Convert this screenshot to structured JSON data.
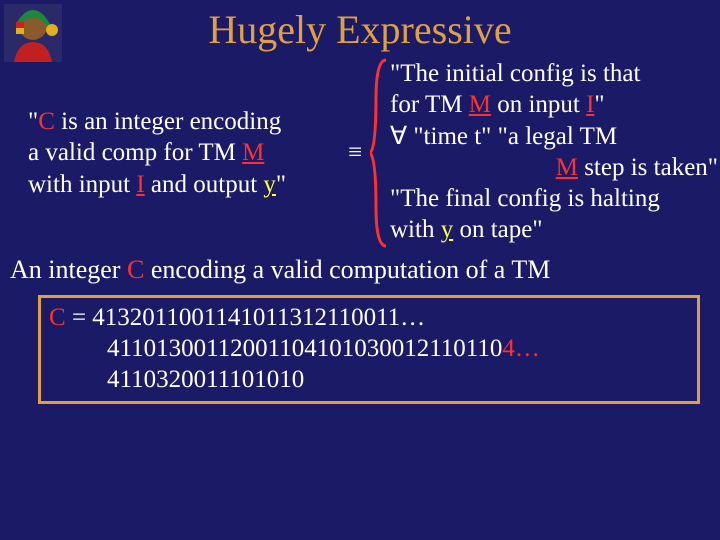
{
  "title": "Hugely Expressive",
  "left": {
    "l1a": "\"",
    "l1b": "C",
    "l1c": " is an integer encoding",
    "l2a": "  a valid comp for TM ",
    "l2b": "M",
    "l3a": "with input ",
    "l3b": "I",
    "l3c": " and output ",
    "l3d": "y",
    "l3e": "\""
  },
  "equiv": "≡",
  "right": {
    "r1a": "\"The initial config is that",
    "r2a": "for TM ",
    "r2b": "M",
    "r2c": " on input ",
    "r2d": "I",
    "r2e": "\"",
    "r3a": "∀ \"time t\" \"a legal TM",
    "r4a": "M",
    "r4b": " step is taken\"",
    "r5a": "\"The final config is halting",
    "r6a": "  with ",
    "r6b": "y",
    "r6c": " on tape\""
  },
  "sentence": {
    "s1": "An integer ",
    "s2": "C",
    "s3": " encoding a valid computation of a TM"
  },
  "box": {
    "b1a": "C",
    "b1b": " = 4132011001141011312110011…",
    "b2": "41101300112001104101030012110110",
    "b2suffix": "4…",
    "b3": "4110320011101010"
  }
}
